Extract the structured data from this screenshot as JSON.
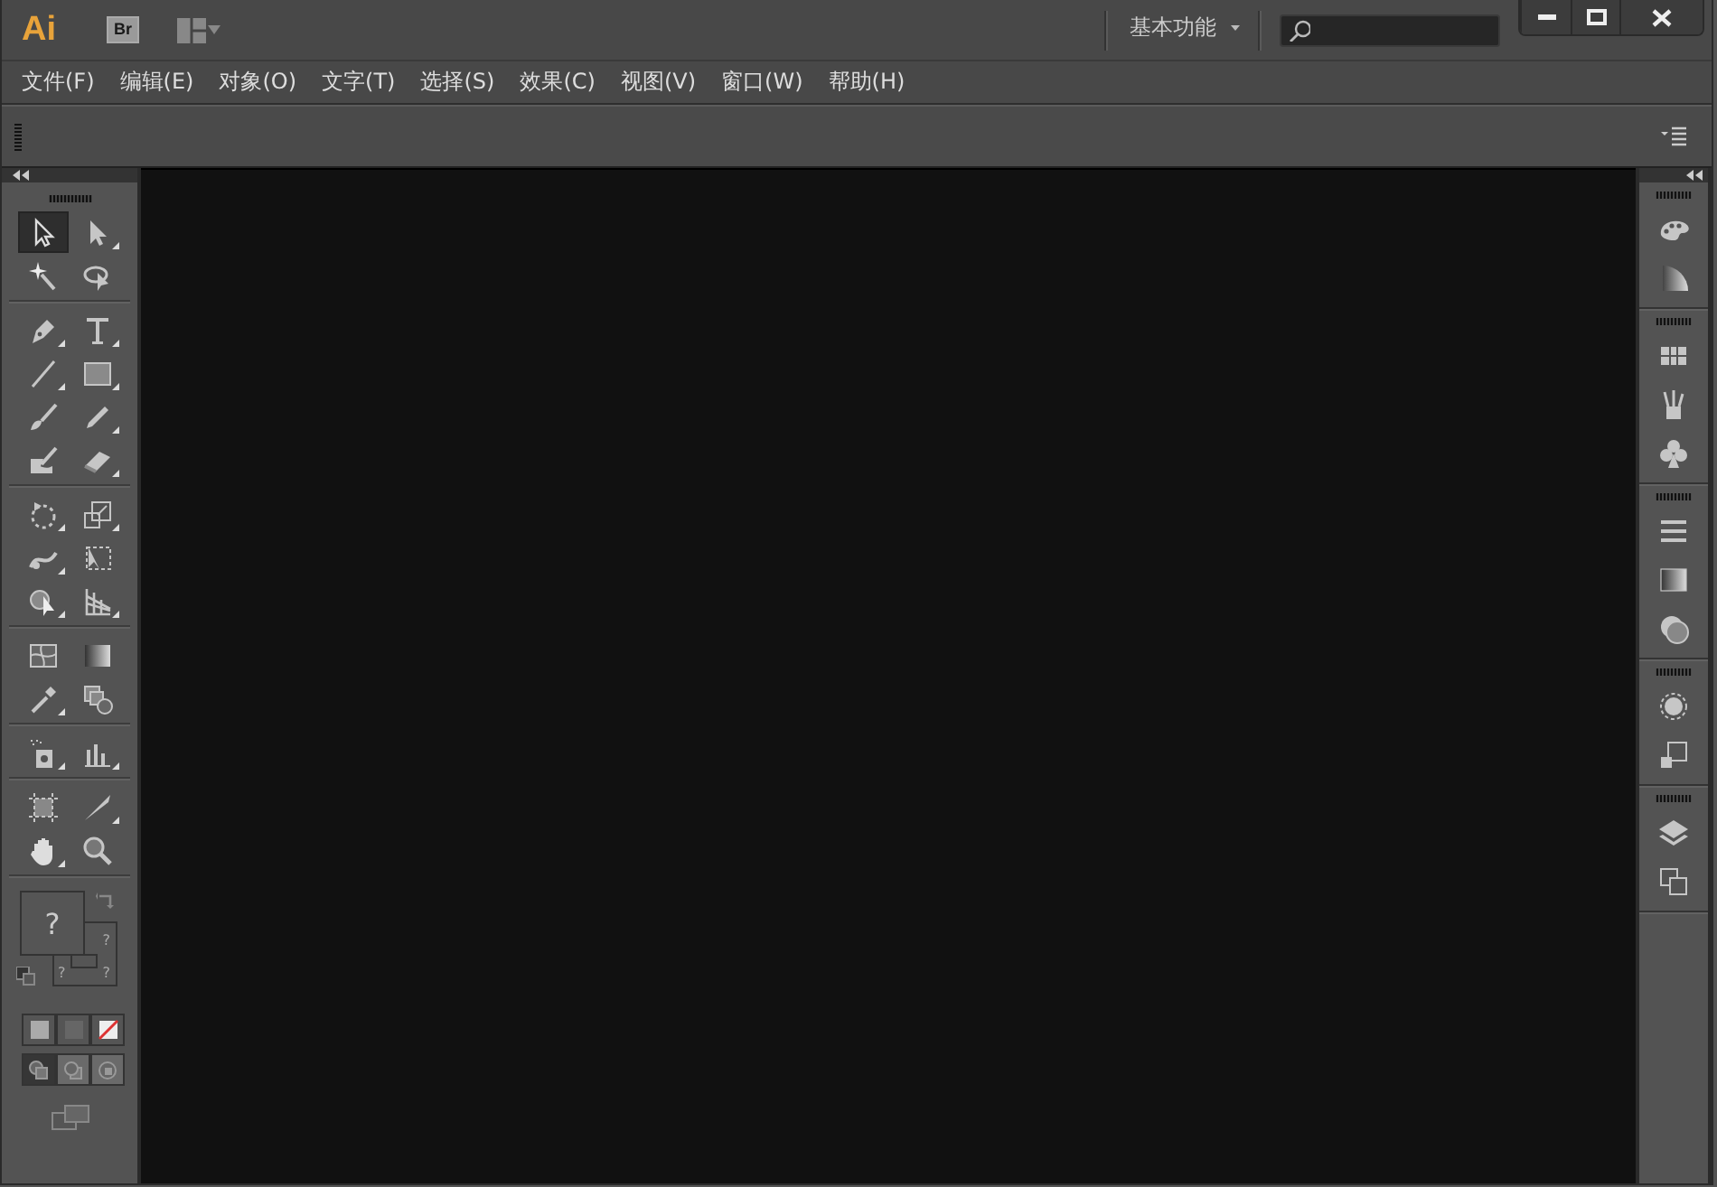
{
  "titlebar": {
    "logo": "Ai",
    "bridge_button": "Br",
    "workspace": "基本功能"
  },
  "menu": [
    "文件(F)",
    "编辑(E)",
    "对象(O)",
    "文字(T)",
    "选择(S)",
    "效果(C)",
    "视图(V)",
    "窗口(W)",
    "帮助(H)"
  ],
  "tool_groups": [
    [
      {
        "kind": "selection",
        "selected": true,
        "flyout": false
      },
      {
        "kind": "direct-selection",
        "selected": false,
        "flyout": true
      },
      {
        "kind": "magic-wand",
        "selected": false,
        "flyout": false
      },
      {
        "kind": "lasso",
        "selected": false,
        "flyout": false
      }
    ],
    [
      {
        "kind": "pen",
        "selected": false,
        "flyout": true
      },
      {
        "kind": "type",
        "selected": false,
        "flyout": true
      },
      {
        "kind": "line",
        "selected": false,
        "flyout": true
      },
      {
        "kind": "rectangle",
        "selected": false,
        "flyout": true
      },
      {
        "kind": "brush",
        "selected": false,
        "flyout": false
      },
      {
        "kind": "pencil",
        "selected": false,
        "flyout": true
      },
      {
        "kind": "blob",
        "selected": false,
        "flyout": false
      },
      {
        "kind": "eraser",
        "selected": false,
        "flyout": true
      }
    ],
    [
      {
        "kind": "rotate",
        "selected": false,
        "flyout": true
      },
      {
        "kind": "scale",
        "selected": false,
        "flyout": true
      },
      {
        "kind": "warp",
        "selected": false,
        "flyout": true
      },
      {
        "kind": "free-transform",
        "selected": false,
        "flyout": false
      },
      {
        "kind": "shape-builder",
        "selected": false,
        "flyout": true
      },
      {
        "kind": "perspective",
        "selected": false,
        "flyout": true
      }
    ],
    [
      {
        "kind": "mesh",
        "selected": false,
        "flyout": false
      },
      {
        "kind": "gradient",
        "selected": false,
        "flyout": false
      },
      {
        "kind": "eyedropper",
        "selected": false,
        "flyout": true
      },
      {
        "kind": "blend",
        "selected": false,
        "flyout": false
      }
    ],
    [
      {
        "kind": "symbol-sprayer",
        "selected": false,
        "flyout": true
      },
      {
        "kind": "graph",
        "selected": false,
        "flyout": true
      }
    ],
    [
      {
        "kind": "artboard",
        "selected": false,
        "flyout": false
      },
      {
        "kind": "slice",
        "selected": false,
        "flyout": true
      },
      {
        "kind": "hand",
        "selected": false,
        "flyout": true
      },
      {
        "kind": "zoom",
        "selected": false,
        "flyout": false
      }
    ]
  ],
  "fill_stroke": {
    "fill_mark": "?",
    "stroke_marks": [
      "?",
      "?",
      "?"
    ]
  },
  "color_modes": [
    {
      "kind": "color"
    },
    {
      "kind": "gradient"
    },
    {
      "kind": "none"
    }
  ],
  "draw_modes": [
    {
      "kind": "normal",
      "selected": true
    },
    {
      "kind": "behind",
      "selected": false
    },
    {
      "kind": "inside",
      "selected": false
    }
  ],
  "dock_groups": [
    [
      {
        "kind": "color"
      },
      {
        "kind": "color-guide"
      }
    ],
    [
      {
        "kind": "swatches"
      },
      {
        "kind": "brushes"
      },
      {
        "kind": "symbols"
      }
    ],
    [
      {
        "kind": "stroke"
      },
      {
        "kind": "gradient"
      },
      {
        "kind": "transparency"
      }
    ],
    [
      {
        "kind": "appearance"
      },
      {
        "kind": "graphic-styles"
      }
    ],
    [
      {
        "kind": "layers"
      },
      {
        "kind": "artboards"
      }
    ]
  ]
}
